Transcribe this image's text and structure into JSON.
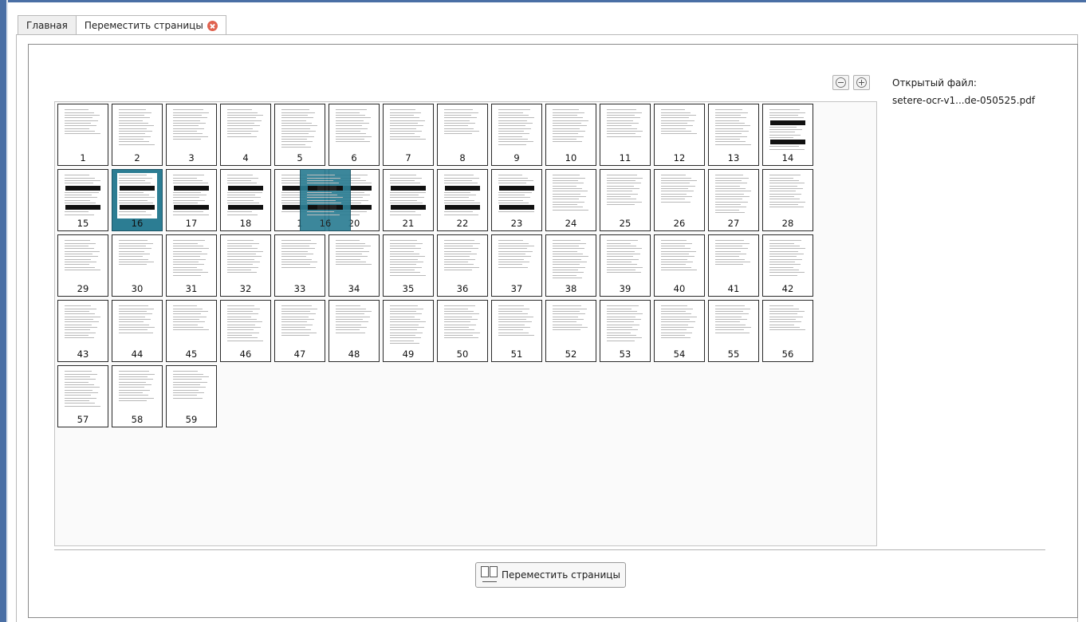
{
  "tabs": [
    {
      "label": "Главная",
      "active": false
    },
    {
      "label": "Переместить страницы",
      "active": true
    }
  ],
  "zoom": {
    "out_icon": "zoom-out-icon",
    "in_icon": "zoom-in-icon"
  },
  "file": {
    "label": "Открытый файл:",
    "name": "setere-ocr-v1...de-050525.pdf"
  },
  "pages": {
    "count": 59,
    "selected": 16,
    "dragging_label": "16",
    "dark_pages": [
      14,
      15,
      16,
      17,
      18,
      19,
      20,
      21,
      22,
      23
    ],
    "labels": [
      "1",
      "2",
      "3",
      "4",
      "5",
      "6",
      "7",
      "8",
      "9",
      "10",
      "11",
      "12",
      "13",
      "14",
      "15",
      "16",
      "17",
      "18",
      "1",
      "20",
      "21",
      "22",
      "23",
      "24",
      "25",
      "26",
      "27",
      "28",
      "29",
      "30",
      "31",
      "32",
      "33",
      "34",
      "35",
      "36",
      "37",
      "38",
      "39",
      "40",
      "41",
      "42",
      "43",
      "44",
      "45",
      "46",
      "47",
      "48",
      "49",
      "50",
      "51",
      "52",
      "53",
      "54",
      "55",
      "56",
      "57",
      "58",
      "59"
    ]
  },
  "action": {
    "move_label": "Переместить страницы"
  },
  "colors": {
    "selection": "#2c7d93",
    "window_frame": "#4a6fa5"
  }
}
